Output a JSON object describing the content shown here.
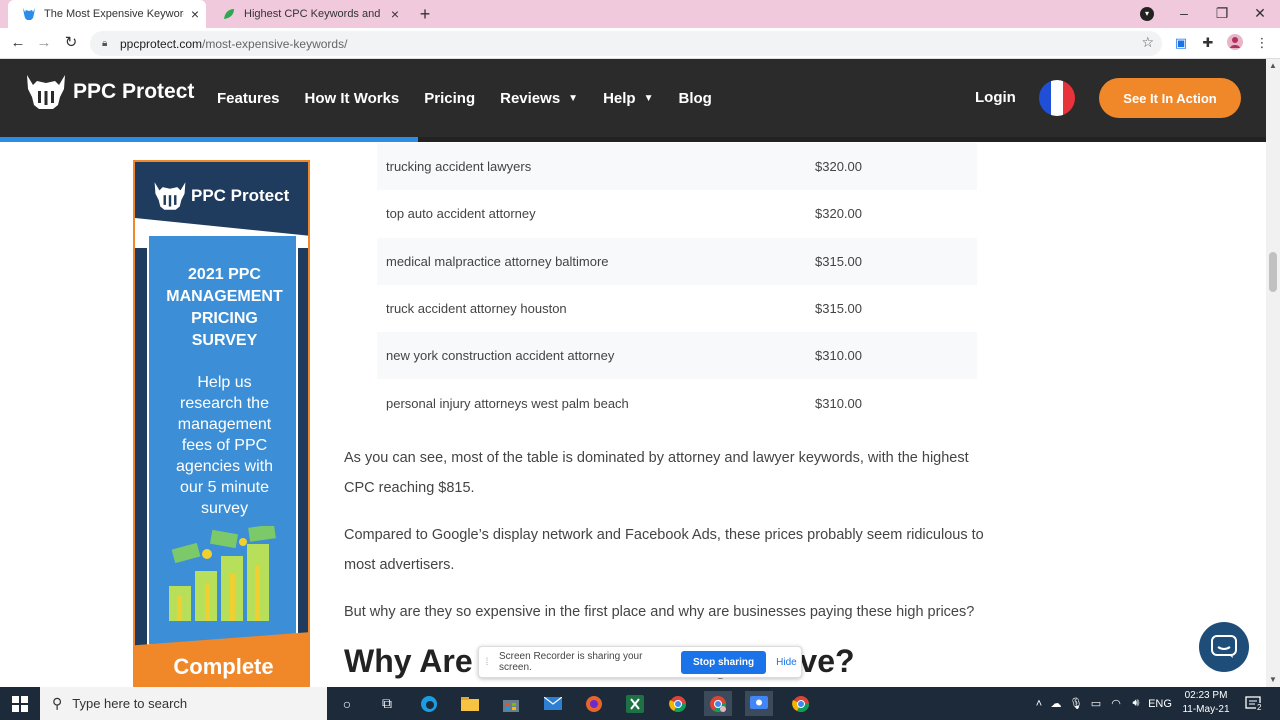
{
  "browser": {
    "tabs": [
      {
        "title": "The Most Expensive Keywords On",
        "active": true
      },
      {
        "title": "Highest CPC Keywords and Best",
        "active": false
      }
    ],
    "new_tab": "+",
    "url_host": "ppcprotect.com",
    "url_path": "/most-expensive-keywords/"
  },
  "site": {
    "brand": "PPC Protect",
    "nav": [
      "Features",
      "How It Works",
      "Pricing",
      "Reviews",
      "Help",
      "Blog"
    ],
    "login": "Login",
    "cta": "See It In Action",
    "read_progress": 0.33,
    "colors": {
      "header": "#2b2b2b",
      "accent": "#f0882a",
      "progress": "#2a8ee8"
    }
  },
  "banner": {
    "brand": "PPC Protect",
    "heading_lines": [
      "2021 PPC",
      "MANAGEMENT",
      "PRICING",
      "SURVEY"
    ],
    "sub_lines": [
      "Help us",
      "research the",
      "management",
      "fees of PPC",
      "agencies with",
      "our 5 minute",
      "survey"
    ],
    "button": "Complete"
  },
  "table": {
    "rows": [
      {
        "keyword": "trucking accident lawyers",
        "cpc": "$320.00"
      },
      {
        "keyword": "top auto accident attorney",
        "cpc": "$320.00"
      },
      {
        "keyword": "medical malpractice attorney baltimore",
        "cpc": "$315.00"
      },
      {
        "keyword": "truck accident attorney houston",
        "cpc": "$315.00"
      },
      {
        "keyword": "new york construction accident attorney",
        "cpc": "$310.00"
      },
      {
        "keyword": "personal injury attorneys west palm beach",
        "cpc": "$310.00"
      }
    ]
  },
  "article": {
    "p1_line1": "As you can see, most of the table is dominated by attorney and lawyer keywords, with the highest",
    "p1_line2": "CPC reaching $815.",
    "p2_line1": "Compared to Google’s display network and Facebook Ads, these prices probably seem ridiculous to",
    "p2_line2": "most advertisers.",
    "p3": "But why are they so expensive in the first place and why are businesses paying these high prices?",
    "h2_left": "Why Are S",
    "h2_right": "pensive?"
  },
  "recorder": {
    "message": "Screen Recorder is sharing your screen.",
    "stop": "Stop sharing",
    "hide": "Hide"
  },
  "taskbar": {
    "search_placeholder": "Type here to search",
    "language": "ENG",
    "time": "02:23 PM",
    "date": "11-May-21",
    "notifications": "2"
  }
}
